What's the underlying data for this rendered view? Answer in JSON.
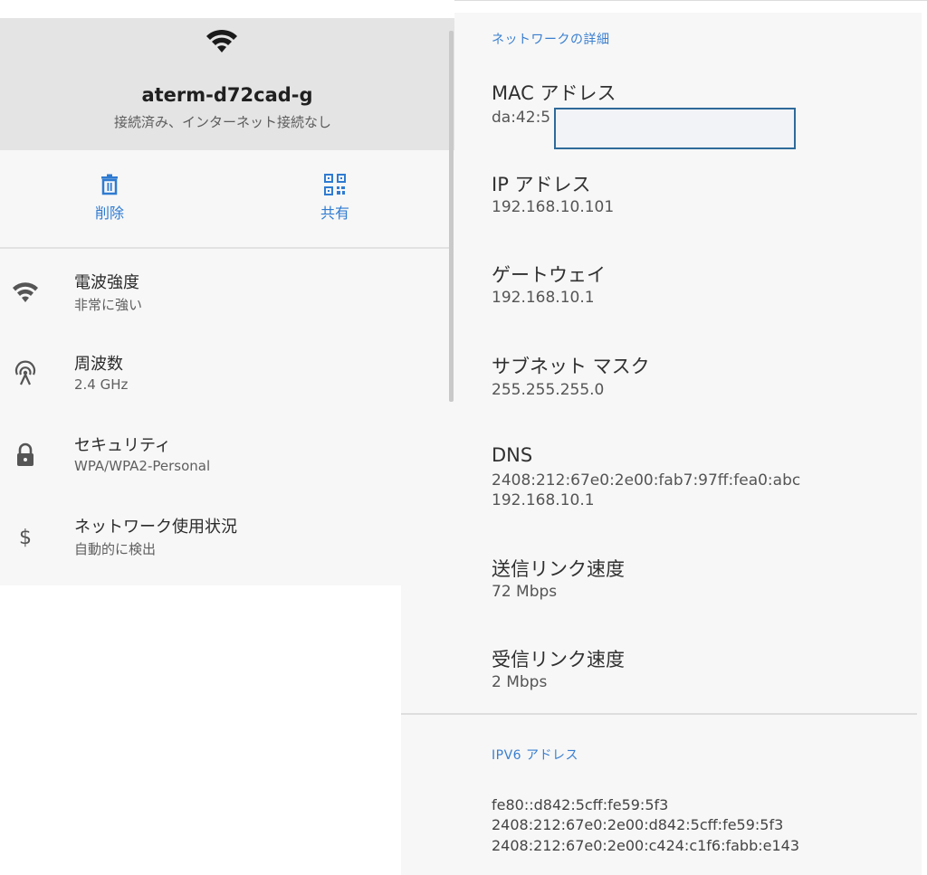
{
  "left": {
    "ssid": "aterm-d72cad-g",
    "status": "接続済み、インターネット接続なし",
    "actions": {
      "delete_label": "削除",
      "share_label": "共有"
    },
    "rows": [
      {
        "title": "電波強度",
        "value": "非常に強い",
        "icon": "wifi-signal-icon"
      },
      {
        "title": "周波数",
        "value": "2.4 GHz",
        "icon": "antenna-icon"
      },
      {
        "title": "セキュリティ",
        "value": "WPA/WPA2-Personal",
        "icon": "lock-icon"
      },
      {
        "title": "ネットワーク使用状況",
        "value": "自動的に検出",
        "icon": "dollar-icon"
      }
    ]
  },
  "details": {
    "section_title": "ネットワークの詳細",
    "mac": {
      "label": "MAC アドレス",
      "value": "da:42:5"
    },
    "ip": {
      "label": "IP アドレス",
      "value": "192.168.10.101"
    },
    "gateway": {
      "label": "ゲートウェイ",
      "value": "192.168.10.1"
    },
    "subnet": {
      "label": "サブネット マスク",
      "value": "255.255.255.0"
    },
    "dns": {
      "label": "DNS",
      "values": [
        "2408:212:67e0:2e00:fab7:97ff:fea0:abc",
        "192.168.10.1"
      ]
    },
    "tx_speed": {
      "label": "送信リンク速度",
      "value": "72 Mbps"
    },
    "rx_speed": {
      "label": "受信リンク速度",
      "value": "2 Mbps"
    }
  },
  "ipv6": {
    "section_title": "IPV6 アドレス",
    "addresses": [
      "fe80::d842:5cff:fe59:5f3",
      "2408:212:67e0:2e00:d842:5cff:fe59:5f3",
      "2408:212:67e0:2e00:c424:c1f6:fabb:e143"
    ]
  },
  "colors": {
    "accent": "#2f7bd1",
    "header_bg": "#e4e4e4",
    "panel_bg": "#f7f7f7"
  }
}
